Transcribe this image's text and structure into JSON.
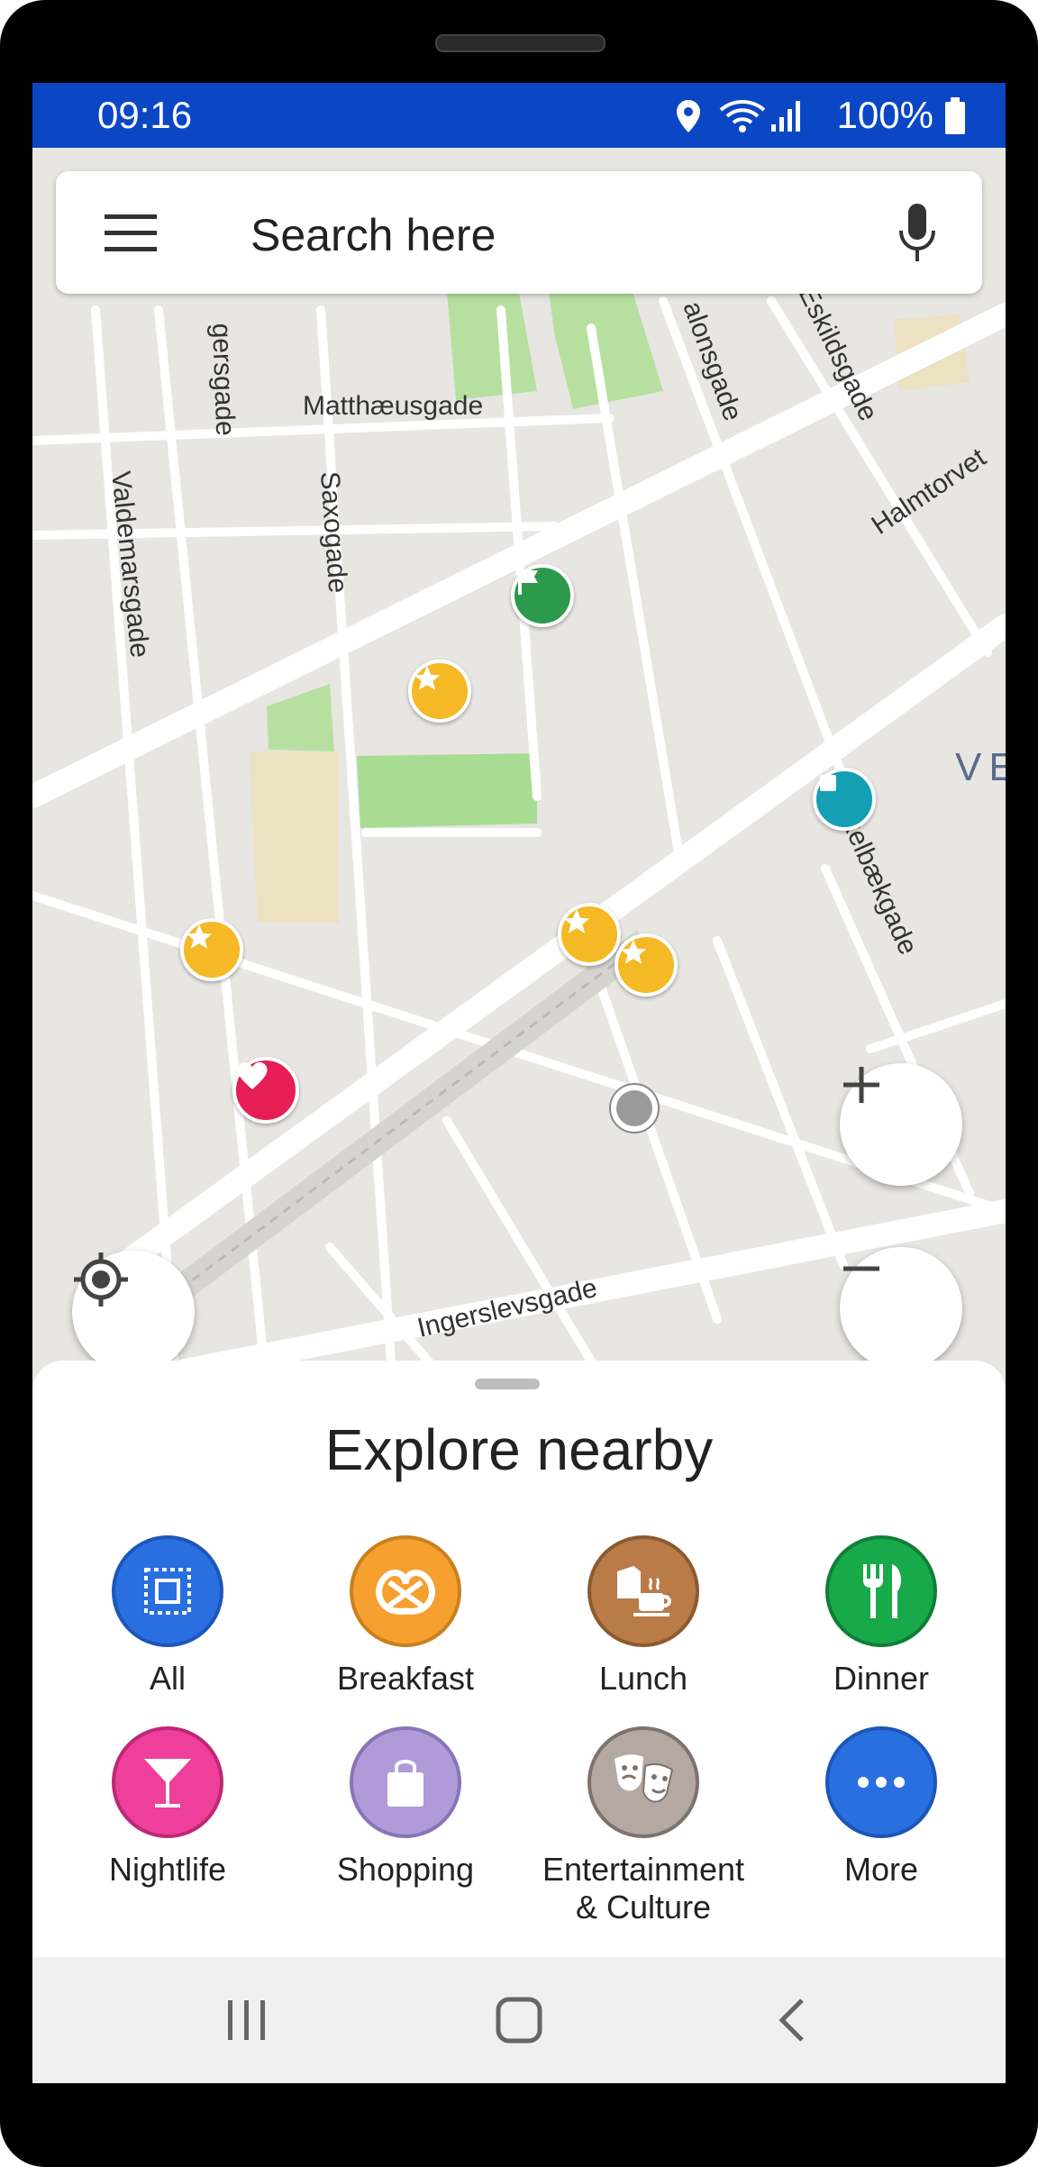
{
  "status_bar": {
    "time": "09:16",
    "battery": "100%"
  },
  "search": {
    "placeholder": "Search here"
  },
  "map": {
    "streets": [
      "Matthæusgade",
      "Saxogade",
      "Valdemarsgade",
      "Eskildsgade",
      "Halmtorvet",
      "Skelbækgade",
      "Ingerslevsgade",
      "gersgade",
      "alonsgade",
      "VE"
    ]
  },
  "explore": {
    "title": "Explore nearby",
    "categories": [
      {
        "label": "All",
        "color": "#2a6fe0",
        "icon": "grid-icon"
      },
      {
        "label": "Breakfast",
        "color": "#f6a030",
        "icon": "pretzel-icon"
      },
      {
        "label": "Lunch",
        "color": "#b97b47",
        "icon": "lunch-icon"
      },
      {
        "label": "Dinner",
        "color": "#17a94a",
        "icon": "cutlery-icon"
      },
      {
        "label": "Nightlife",
        "color": "#ee3f9b",
        "icon": "cocktail-icon"
      },
      {
        "label": "Shopping",
        "color": "#b09ad8",
        "icon": "shopping-bag-icon"
      },
      {
        "label": "Entertainment\n& Culture",
        "color": "#b3a8a2",
        "icon": "theater-masks-icon"
      },
      {
        "label": "More",
        "color": "#2a6fe0",
        "icon": "more-dots-icon"
      }
    ]
  }
}
